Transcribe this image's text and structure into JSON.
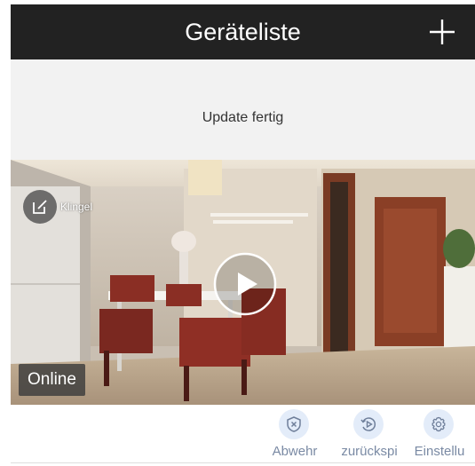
{
  "header": {
    "title": "Geräteliste",
    "add_icon": "plus-icon"
  },
  "banner": {
    "text": "Update fertig"
  },
  "device": {
    "name": "Klingel",
    "status": "Online",
    "edit_icon": "edit-icon",
    "play_icon": "play-icon"
  },
  "actions": [
    {
      "label": "Abwehr",
      "icon": "shield-x-icon"
    },
    {
      "label": "zurückspi",
      "icon": "playback-icon"
    },
    {
      "label": "Einstellu",
      "icon": "gear-icon"
    }
  ],
  "colors": {
    "header_bg": "#222222",
    "banner_bg": "#f2f2f2",
    "action_icon_bg": "#e3ecf9",
    "action_label": "#7a8aa4"
  }
}
